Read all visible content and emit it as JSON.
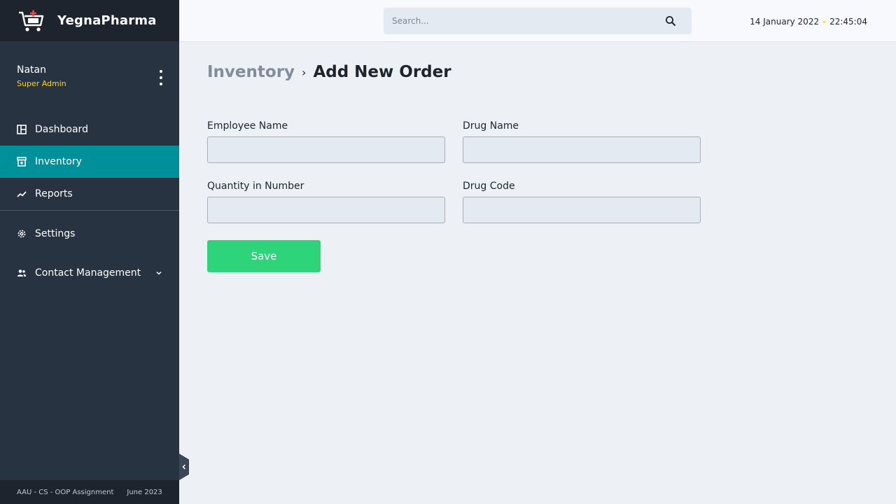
{
  "brand": {
    "name": "YegnaPharma",
    "logo_icon": "pharmacy-cart-icon"
  },
  "user": {
    "name": "Natan",
    "role": "Super Admin"
  },
  "nav": {
    "dashboard": "Dashboard",
    "inventory": "Inventory",
    "reports": "Reports",
    "settings": "Settings",
    "contact_management": "Contact Management"
  },
  "footer": {
    "course": "AAU - CS - OOP Assignment",
    "date": "June 2023"
  },
  "search": {
    "placeholder": "Search..."
  },
  "datetime": {
    "date": "14 January 2022",
    "time": "22:45:04"
  },
  "breadcrumb": {
    "parent": "Inventory",
    "separator": "›",
    "current": "Add New Order"
  },
  "form": {
    "employee_name_label": "Employee Name",
    "drug_name_label": "Drug Name",
    "quantity_label": "Quantity in Number",
    "drug_code_label": "Drug Code",
    "save_label": "Save"
  },
  "colors": {
    "sidebar_bg": "#283342",
    "sidebar_dark": "#1d242e",
    "active_nav": "#009099",
    "accent_yellow": "#fed600",
    "save_green": "#2ed47a",
    "logo_red": "#f0483e"
  }
}
